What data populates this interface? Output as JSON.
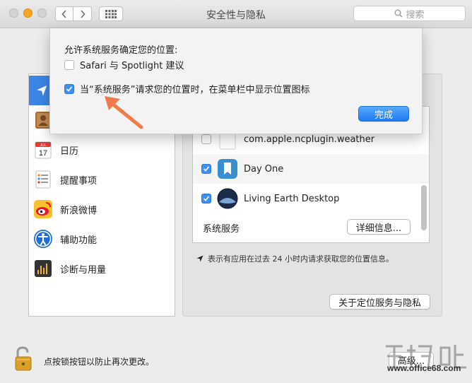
{
  "window": {
    "title": "安全性与隐私"
  },
  "search": {
    "placeholder": "搜索"
  },
  "sidebar": {
    "items": [
      {
        "label": "",
        "icon": "location-arrow-icon"
      },
      {
        "label": "",
        "icon": "contacts-icon"
      },
      {
        "label": "日历",
        "icon": "calendar-icon",
        "calendar_month": "JUL",
        "calendar_day": "17"
      },
      {
        "label": "提醒事项",
        "icon": "reminders-icon"
      },
      {
        "label": "新浪微博",
        "icon": "weibo-icon"
      },
      {
        "label": "辅助功能",
        "icon": "accessibility-icon"
      },
      {
        "label": "诊断与用量",
        "icon": "diagnostics-icon"
      }
    ]
  },
  "apps": {
    "rows": [
      {
        "label": "com.apple.ncplugin.weather",
        "checked": false
      },
      {
        "label": "Day One",
        "checked": true
      },
      {
        "label": "Living Earth Desktop",
        "checked": true
      }
    ],
    "system_services_label": "系统服务",
    "details_button": "详细信息..."
  },
  "note": {
    "text": "表示有应用在过去 24 小时内请求获取您的位置信息。"
  },
  "about_button": "关于定位服务与隐私",
  "footer": {
    "lock_text": "点按锁按钮以防止再次更改。",
    "advanced_button": "高级..."
  },
  "sheet": {
    "title": "允许系统服务确定您的位置:",
    "option1": {
      "label": "Safari 与 Spotlight 建议",
      "checked": false
    },
    "option2": {
      "label": "当“系统服务”请求您的位置时，在菜单栏中显示位置图标",
      "checked": true
    },
    "done_button": "完成"
  },
  "watermark": {
    "url": "www.office68.com"
  },
  "colors": {
    "accent": "#3b86e4",
    "checkbox": "#3d8ff0",
    "arrow": "#f07a4a",
    "lock": "#d9a128"
  }
}
